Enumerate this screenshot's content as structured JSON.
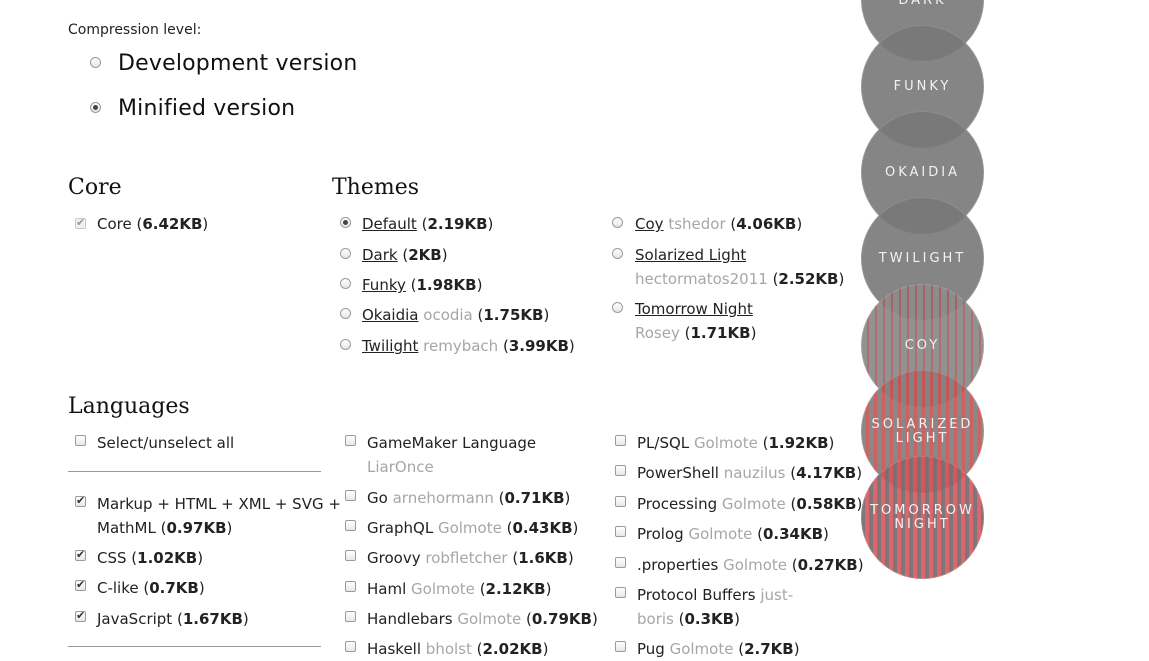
{
  "compression": {
    "label": "Compression level:",
    "options": [
      {
        "label": "Development version",
        "selected": false
      },
      {
        "label": "Minified version",
        "selected": true
      }
    ]
  },
  "core": {
    "heading": "Core",
    "item": {
      "label": "Core",
      "size": "6.42KB",
      "checked": true
    }
  },
  "themes": {
    "heading": "Themes",
    "col1": [
      {
        "name": "Default",
        "author": "",
        "size": "2.19KB",
        "selected": true
      },
      {
        "name": "Dark",
        "author": "",
        "size": "2KB",
        "selected": false
      },
      {
        "name": "Funky",
        "author": "",
        "size": "1.98KB",
        "selected": false
      },
      {
        "name": "Okaidia",
        "author": "ocodia",
        "size": "1.75KB",
        "selected": false
      },
      {
        "name": "Twilight",
        "author": "remybach",
        "size": "3.99KB",
        "selected": false
      }
    ],
    "col2": [
      {
        "name": "Coy",
        "author": "tshedor",
        "size": "4.06KB"
      },
      {
        "name": "Solarized Light",
        "author": "hectormatos2011",
        "size": "2.52KB"
      },
      {
        "name": "Tomorrow Night",
        "author": "Rosey",
        "size": "1.71KB"
      }
    ]
  },
  "languages": {
    "heading": "Languages",
    "select_all": "Select/unselect all",
    "col1": [
      {
        "line1": "Markup + HTML + XML + SVG +",
        "line2": "MathML",
        "size": "0.97KB",
        "checked": true
      },
      {
        "name": "CSS",
        "size": "1.02KB",
        "checked": true
      },
      {
        "name": "C-like",
        "size": "0.7KB",
        "checked": true
      },
      {
        "name": "JavaScript",
        "size": "1.67KB",
        "checked": true
      }
    ],
    "col2": [
      {
        "name": "GameMaker Language",
        "author": "LiarOnce",
        "size": ""
      },
      {
        "name": "Go",
        "author": "arnehormann",
        "size": "0.71KB"
      },
      {
        "name": "GraphQL",
        "author": "Golmote",
        "size": "0.43KB"
      },
      {
        "name": "Groovy",
        "author": "robfletcher",
        "size": "1.6KB"
      },
      {
        "name": "Haml",
        "author": "Golmote",
        "size": "2.12KB"
      },
      {
        "name": "Handlebars",
        "author": "Golmote",
        "size": "0.79KB"
      },
      {
        "name": "Haskell",
        "author": "bholst",
        "size": "2.02KB"
      }
    ],
    "col3": [
      {
        "name": "PL/SQL",
        "author": "Golmote",
        "size": "1.92KB"
      },
      {
        "name": "PowerShell",
        "author": "nauzilus",
        "size": "4.17KB"
      },
      {
        "name": "Processing",
        "author": "Golmote",
        "size": "0.58KB"
      },
      {
        "name": "Prolog",
        "author": "Golmote",
        "size": "0.34KB"
      },
      {
        "name": ".properties",
        "author": "Golmote",
        "size": "0.27KB"
      },
      {
        "name": "Protocol Buffers",
        "author": "just-",
        "author2": "boris",
        "size": "0.3KB"
      },
      {
        "name": "Pug",
        "author": "Golmote",
        "size": "2.7KB"
      }
    ]
  },
  "theme_switcher": [
    {
      "label": "DARK"
    },
    {
      "label": "FUNKY"
    },
    {
      "label": "OKAIDIA"
    },
    {
      "label": "TWILIGHT"
    },
    {
      "label": "COY"
    },
    {
      "label": "SOLARIZED LIGHT"
    },
    {
      "label": "TOMORROW NIGHT"
    }
  ]
}
